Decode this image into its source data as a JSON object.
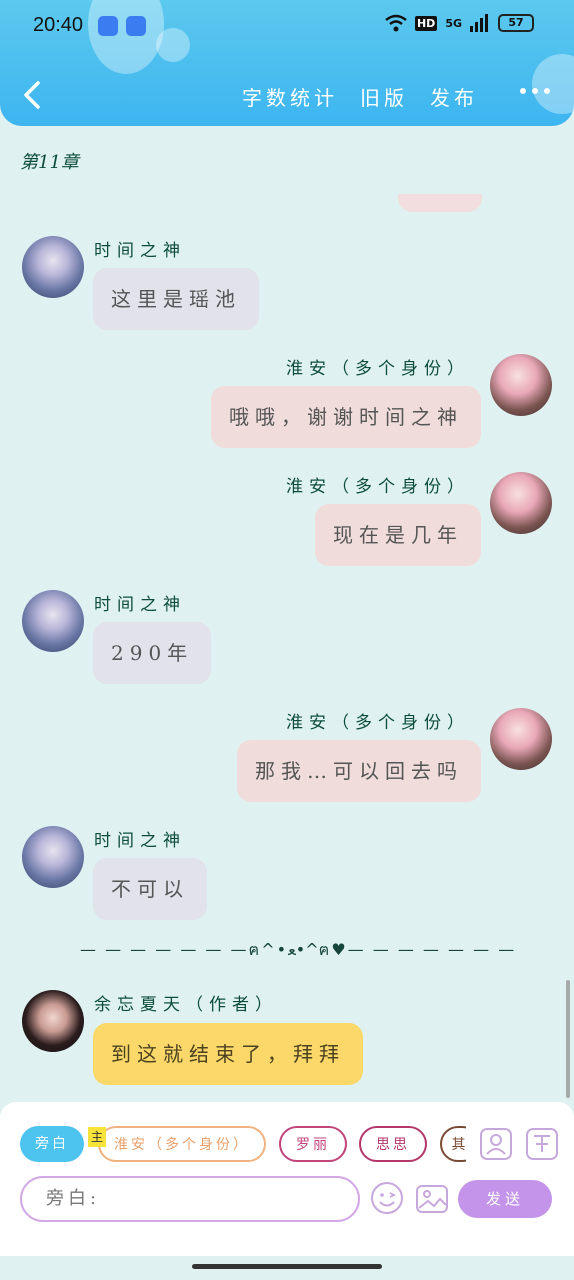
{
  "status_bar": {
    "time": "20:40",
    "hd": "HD",
    "network": "5G",
    "battery": "57"
  },
  "header": {
    "word_count": "字数统计",
    "old_version": "旧版",
    "publish": "发布"
  },
  "chapter_title": "第11章",
  "messages": [
    {
      "side": "left",
      "speaker": "时间之神",
      "text": "这里是瑶池"
    },
    {
      "side": "right",
      "speaker": "淮安（多个身份）",
      "text": "哦哦，谢谢时间之神"
    },
    {
      "side": "right",
      "speaker": "淮安（多个身份）",
      "text": "现在是几年"
    },
    {
      "side": "left",
      "speaker": "时间之神",
      "text": "290年"
    },
    {
      "side": "right",
      "speaker": "淮安（多个身份）",
      "text": "那我…可以回去吗"
    },
    {
      "side": "left",
      "speaker": "时间之神",
      "text": "不可以"
    }
  ],
  "divider": "— — — — — — —ฅ^•ﻌ•^ฅ♥— — — — — — —",
  "author_message": {
    "speaker": "余忘夏天（作者）",
    "text": "到这就结束了，拜拜"
  },
  "composer": {
    "roles": [
      "旁白",
      "淮安（多个身份）",
      "罗丽",
      "思思",
      "其"
    ],
    "main_badge": "主",
    "input_placeholder": "旁白:",
    "send_label": "发送"
  },
  "icons": {
    "back": "chevron-left-icon",
    "more": "more-dots-icon",
    "role_card": "person-card-icon",
    "tag": "tag-icon",
    "emoji": "emoji-icon",
    "image": "image-icon"
  },
  "colors": {
    "header": "#3db5f0",
    "background": "#dff1f1",
    "left_bubble": "#e1e2ea",
    "right_bubble": "#f1dcdc",
    "author_bubble": "#fbd869",
    "name_text": "#0e4d3c",
    "send_button": "#c394ea"
  }
}
